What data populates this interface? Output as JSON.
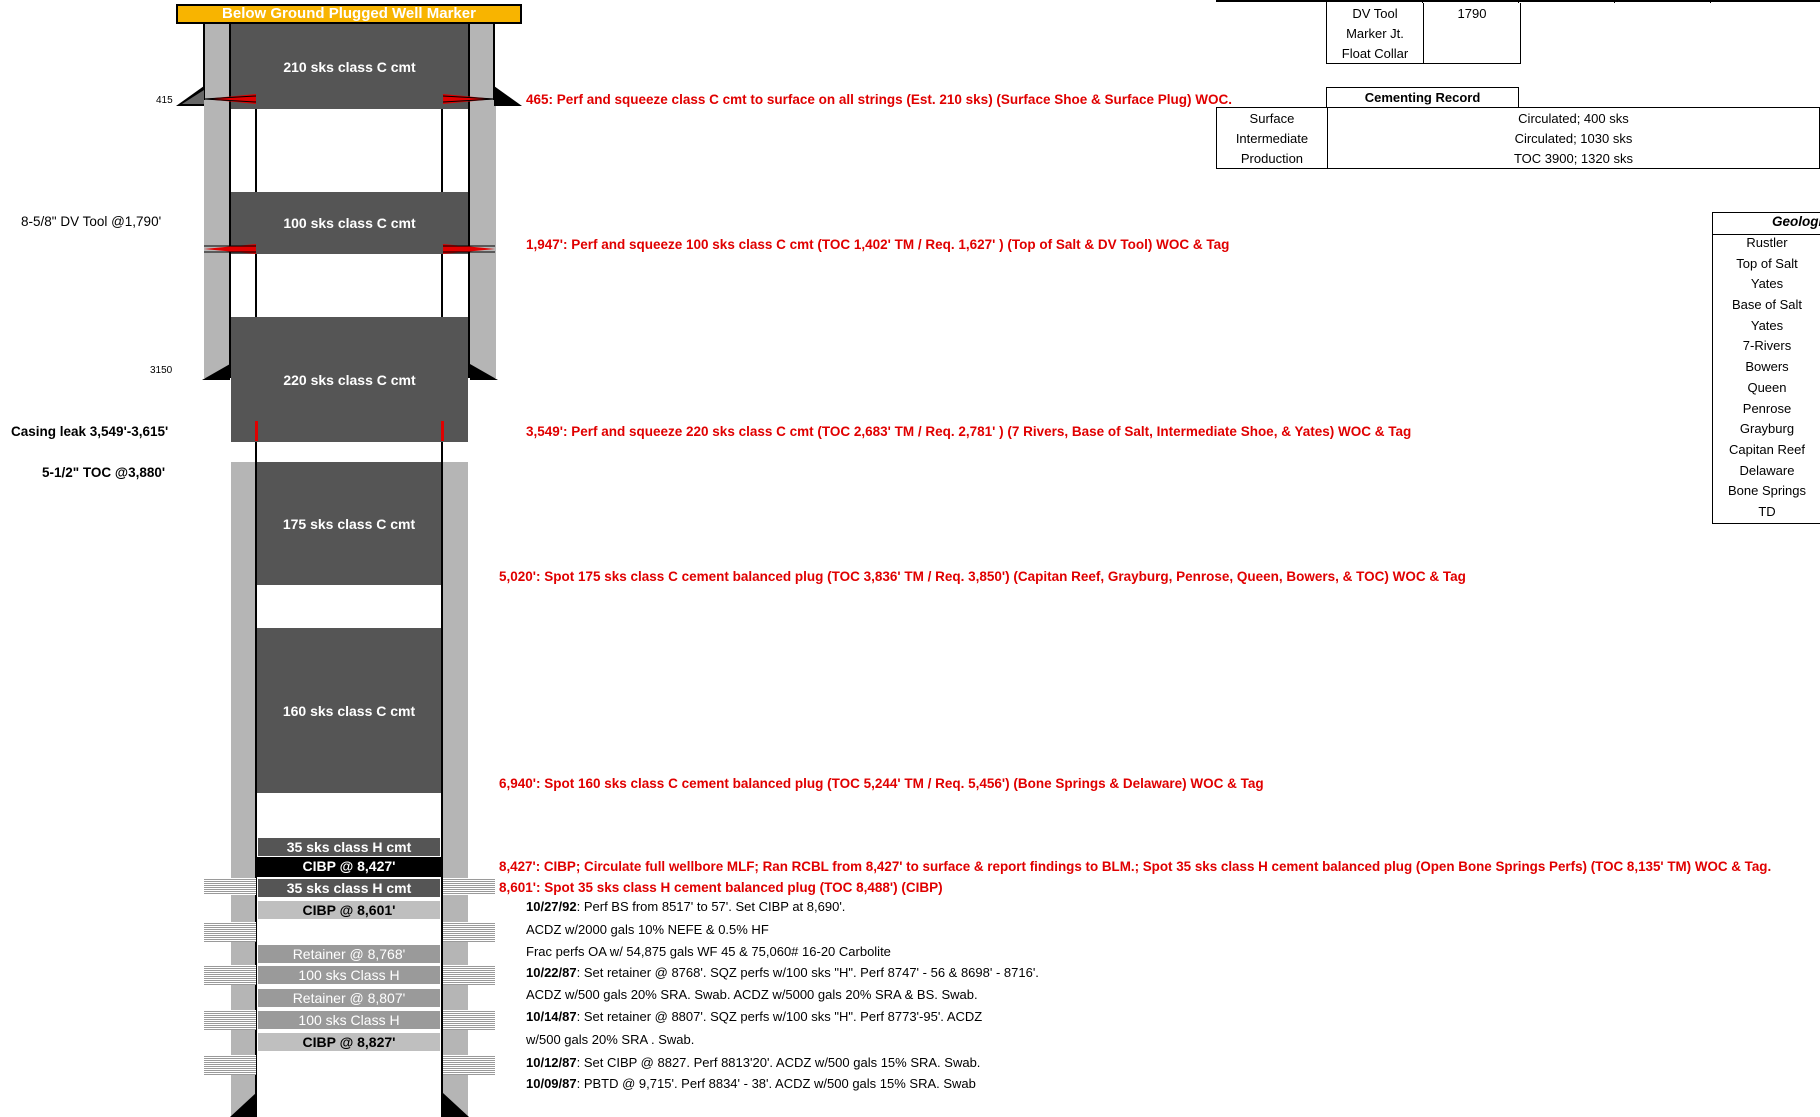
{
  "marker": "Below Ground Plugged Well Marker",
  "depth_ticks": {
    "d415": "415",
    "d3150": "3150"
  },
  "left_labels": {
    "dv_tool": "8-5/8\" DV Tool @1,790'",
    "casing_leak": "Casing leak 3,549'-3,615'",
    "toc": "5-1/2\" TOC @3,880'"
  },
  "plugs": {
    "p1": "210 sks class C cmt",
    "p2": "100 sks class C cmt",
    "p3": "220 sks class C cmt",
    "p4": "175 sks class C cmt",
    "p5": "160 sks class C cmt",
    "p6": "35 sks class H cmt",
    "cibp1": "CIBP @ 8,427'",
    "p7": "35 sks class H cmt",
    "cibp2": "CIBP @ 8,601'",
    "ret1": "Retainer @ 8,768'",
    "sqz1": "100 sks Class H",
    "ret2": "Retainer @ 8,807'",
    "sqz2": "100 sks Class H",
    "cibp3": "CIBP @ 8,827'"
  },
  "annotations": {
    "a1": "465: Perf and squeeze class C cmt to surface on all strings (Est. 210 sks) (Surface Shoe & Surface Plug) WOC.",
    "a2": "1,947': Perf and squeeze 100 sks class C cmt (TOC 1,402' TM / Req. 1,627' ) (Top of Salt & DV Tool) WOC & Tag",
    "a3": "3,549': Perf and squeeze 220 sks class C cmt (TOC 2,683' TM / Req. 2,781' ) (7 Rivers, Base of Salt, Intermediate Shoe, & Yates) WOC & Tag",
    "a4": "5,020': Spot 175 sks class C cement balanced plug (TOC 3,836' TM / Req. 3,850') (Capitan Reef, Grayburg, Penrose, Queen, Bowers, & TOC) WOC & Tag",
    "a5": "6,940': Spot 160 sks class C cement balanced plug (TOC 5,244' TM / Req. 5,456') (Bone Springs & Delaware) WOC & Tag",
    "a6": "8,427': CIBP; Circulate full wellbore MLF; Ran RCBL from 8,427' to surface & report findings to BLM.; Spot 35 sks class H cement balanced plug (Open Bone Springs Perfs) (TOC 8,135' TM) WOC & Tag.",
    "a7": "8,601': Spot 35 sks class H cement balanced plug (TOC 8,488') (CIBP)"
  },
  "history": {
    "h1_date": "10/27/92",
    "h1_text": ": Perf BS from 8517' to 57'. Set CIBP at 8,690'.",
    "h2": "ACDZ w/2000 gals 10% NEFE & 0.5% HF",
    "h3": "Frac perfs OA w/ 54,875 gals WF 45 & 75,060# 16-20 Carbolite",
    "h4_date": "10/22/87",
    "h4_text": ": Set retainer @ 8768'. SQZ perfs w/100 sks \"H\". Perf 8747' - 56 & 8698' - 8716'.",
    "h5": "ACDZ w/500 gals 20% SRA. Swab. ACDZ w/5000 gals 20% SRA & BS. Swab.",
    "h6_date": "10/14/87",
    "h6_text": ": Set retainer @ 8807'. SQZ perfs w/100 sks \"H\". Perf 8773'-95'. ACDZ",
    "h7": "w/500 gals 20% SRA . Swab.",
    "h8_date": "10/12/87",
    "h8_text": ": Set CIBP @ 8827. Perf 8813'20'. ACDZ w/500 gals 15% SRA. Swab.",
    "h9_date": "10/09/87",
    "h9_text": ": PBTD @ 9,715'. Perf 8834' - 38'. ACDZ w/500 gals 15% SRA. Swab"
  },
  "top_table": {
    "r1c1": "DV Tool",
    "r1c2": "1790",
    "r2c1": "Marker Jt.",
    "r3c1": "Float Collar"
  },
  "cementing": {
    "title": "Cementing Record",
    "rows": [
      {
        "name": "Surface",
        "value": "Circulated; 400 sks"
      },
      {
        "name": "Intermediate",
        "value": "Circulated; 1030 sks"
      },
      {
        "name": "Production",
        "value": "TOC 3900; 1320 sks"
      }
    ]
  },
  "geology": {
    "title": "Geologi",
    "items": [
      "Rustler",
      "Top of Salt",
      "Yates",
      "Base of Salt",
      "Yates",
      "7-Rivers",
      "Bowers",
      "Queen",
      "Penrose",
      "Grayburg",
      "Capitan Reef",
      "Delaware",
      "Bone Springs",
      "TD"
    ]
  },
  "colors": {
    "cement": "#555555",
    "casing": "#b5b5b5",
    "annotation": "#e00000",
    "marker": "#f8b400"
  }
}
